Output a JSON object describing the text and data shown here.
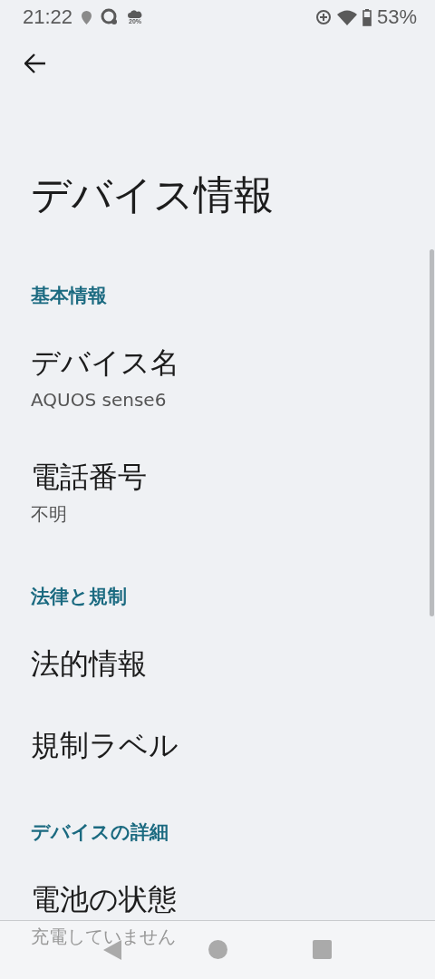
{
  "status_bar": {
    "time": "21:22",
    "weather_badge": "20%",
    "battery": "53%"
  },
  "title": "デバイス情報",
  "sections": [
    {
      "title": "基本情報",
      "items": [
        {
          "title": "デバイス名",
          "summary": "AQUOS sense6"
        },
        {
          "title": "電話番号",
          "summary": "不明"
        }
      ]
    },
    {
      "title": "法律と規制",
      "items": [
        {
          "title": "法的情報"
        },
        {
          "title": "規制ラベル"
        }
      ]
    },
    {
      "title": "デバイスの詳細",
      "items": [
        {
          "title": "電池の状態",
          "summary": "充電していません"
        }
      ]
    }
  ]
}
